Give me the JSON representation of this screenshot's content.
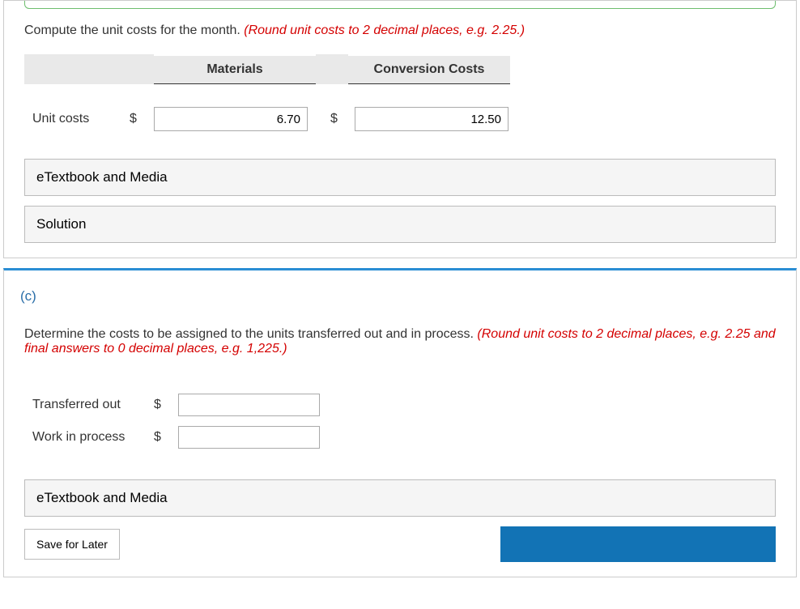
{
  "part_b": {
    "prompt_main": "Compute the unit costs for the month. ",
    "prompt_hint": "(Round unit costs to 2 decimal places, e.g. 2.25.)",
    "col1": "Materials",
    "col2": "Conversion Costs",
    "row_label": "Unit costs",
    "currency": "$",
    "val_materials": "6.70",
    "val_conversion": "12.50",
    "etext": "eTextbook and Media",
    "solution": "Solution"
  },
  "part_c": {
    "label": "(c)",
    "prompt_main": "Determine the costs to be assigned to the units transferred out and in process. ",
    "prompt_hint": "(Round unit costs to 2 decimal places, e.g. 2.25 and final answers to 0 decimal places, e.g. 1,225.)",
    "row1": "Transferred out",
    "row2": "Work in process",
    "currency": "$",
    "val1": "",
    "val2": "",
    "etext": "eTextbook and Media",
    "save": "Save for Later"
  }
}
